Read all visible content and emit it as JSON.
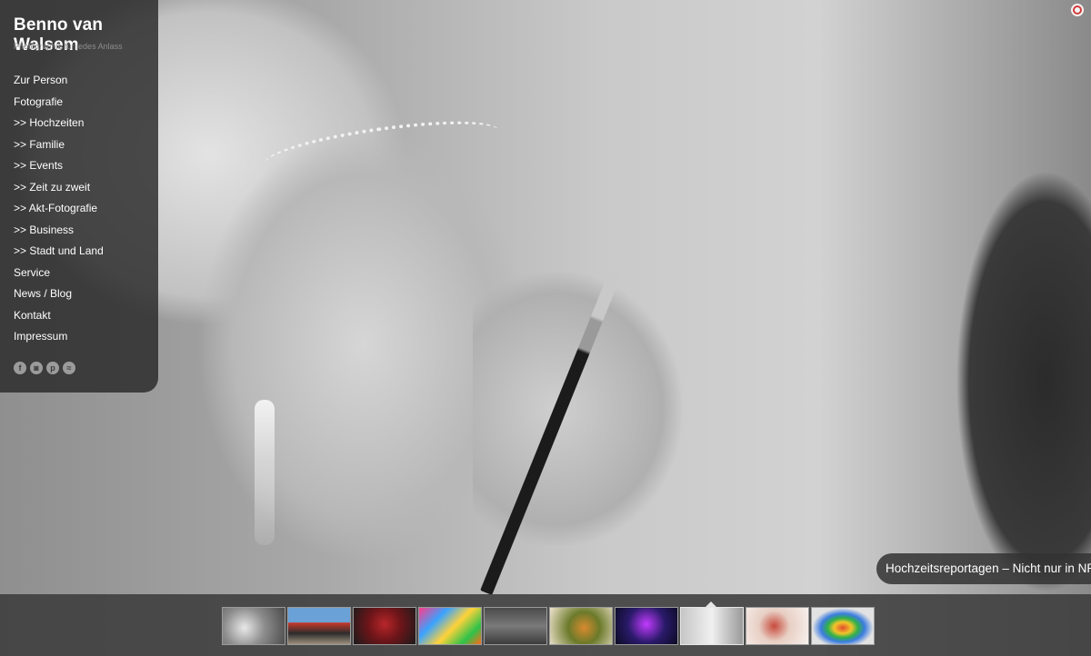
{
  "header": {
    "title": "Benno van Walsem",
    "tagline": "Photographie für jedes Anlass"
  },
  "nav": {
    "items": [
      "Zur Person",
      "Fotografie",
      ">> Hochzeiten",
      ">> Familie",
      ">> Events",
      ">> Zeit zu zweit",
      ">> Akt-Fotografie",
      ">> Business",
      ">> Stadt und Land",
      "Service",
      "News / Blog",
      "Kontakt",
      "Impressum"
    ]
  },
  "social": {
    "facebook": "f",
    "instagram": "◙",
    "pinterest": "p",
    "rss": "≈"
  },
  "caption": {
    "text": "Hochzeitsreportagen – Nicht nur in NRW"
  },
  "gallery": {
    "active_index": 7,
    "thumbnail_count": 10
  },
  "icons": {
    "top_right": "record-ring-icon",
    "social": [
      "facebook-icon",
      "instagram-icon",
      "pinterest-icon",
      "rss-icon"
    ]
  },
  "colors": {
    "accent": "#d13b3b",
    "sidebar_bg": "#282828",
    "text": "#ffffff"
  }
}
